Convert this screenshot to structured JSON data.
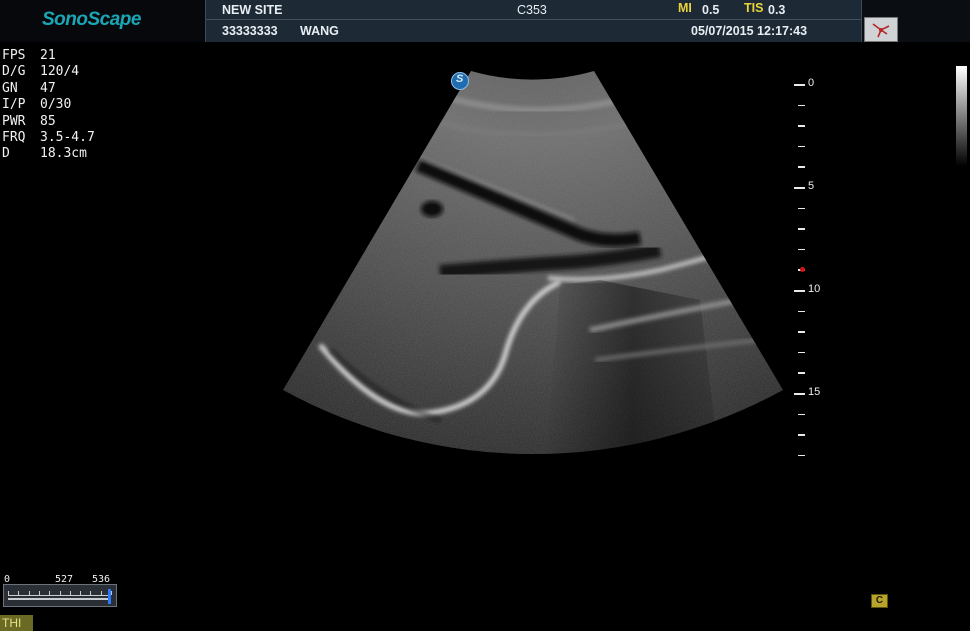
{
  "header": {
    "logo": "SonoScape",
    "site": "NEW SITE",
    "probe_model": "C353",
    "mi_label": "MI",
    "mi_value": "0.5",
    "tis_label": "TIS",
    "tis_value": "0.3",
    "patient_id": "33333333",
    "patient_name": "WANG",
    "datetime": "05/07/2015 12:17:43"
  },
  "params": [
    {
      "key": "FPS",
      "value": "21"
    },
    {
      "key": "D/G",
      "value": "120/4"
    },
    {
      "key": "GN",
      "value": "47"
    },
    {
      "key": "I/P",
      "value": "0/30"
    },
    {
      "key": "PWR",
      "value": "85"
    },
    {
      "key": "FRQ",
      "value": "3.5-4.7"
    },
    {
      "key": "D",
      "value": "18.3cm"
    }
  ],
  "depth_scale": {
    "labels": [
      "0",
      "5",
      "10",
      "15"
    ],
    "unit": "cm",
    "max": 18.3,
    "focus_depth": 9
  },
  "cine": {
    "start_label": "0",
    "current_label": "527",
    "end_label": "536",
    "current": 527,
    "total": 536
  },
  "mode_badge": "THI",
  "orientation_marker": "S",
  "corner_icon": "C",
  "icons": {
    "probe": "probe-icon",
    "orientation": "orientation-marker-icon",
    "c_mode": "c-mode-icon"
  },
  "colors": {
    "logo": "#1aa6b5",
    "header_bg": "#1d2a36",
    "yellow": "#e8d43a",
    "focus": "#d01515",
    "cine_thumb": "#2a7bff"
  }
}
